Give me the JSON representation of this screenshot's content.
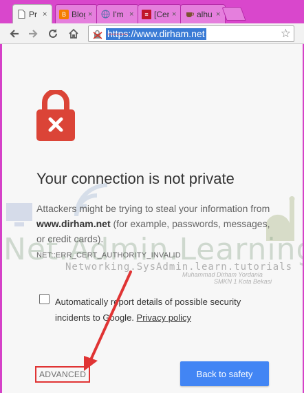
{
  "browser": {
    "tabs": [
      {
        "label": "Pr",
        "favicon": "page-icon",
        "active": true
      },
      {
        "label": "Blog",
        "favicon": "blogger-icon"
      },
      {
        "label": "I'm L",
        "favicon": "globe-icon"
      },
      {
        "label": "[Cen",
        "favicon": "site-red-icon"
      },
      {
        "label": "alhu",
        "favicon": "cup-icon"
      }
    ],
    "tab_close": "×",
    "url_scheme": "https",
    "url_rest": "://www.dirham.net",
    "star": "☆"
  },
  "interstitial": {
    "heading": "Your connection is not private",
    "desc_pre": "Attackers might be trying to steal your information from ",
    "desc_host": "www.dirham.net",
    "desc_post": " (for example, passwords, messages, or credit cards).",
    "error_code": "NET::ERR_CERT_AUTHORITY_INVALID",
    "report_text": "Automatically report details of possible security incidents to Google.",
    "privacy_link": "Privacy policy",
    "advanced_label": "ADVANCED",
    "safety_button": "Back to safety"
  },
  "watermark": {
    "title": "Net.Admin.Learning",
    "subtitle": "Networking.SysAdmin.learn.tutorials",
    "author": "Muhammad Dirham Yordania",
    "school": "SMKN 1 Kota Bekasi"
  },
  "colors": {
    "lock": "#db4437",
    "button": "#4285f4",
    "annotation": "#e03434"
  }
}
